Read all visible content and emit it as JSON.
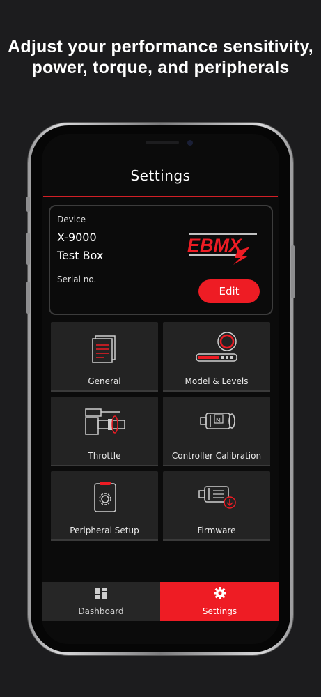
{
  "headline": {
    "line1": "Adjust your performance sensitivity,",
    "line2": "power, torque, and peripherals"
  },
  "header": {
    "title": "Settings"
  },
  "device": {
    "device_label": "Device",
    "name_line1": "X-9000",
    "name_line2": "Test Box",
    "serial_label": "Serial no.",
    "serial_value": "--",
    "logo_text": "EBMX",
    "edit_label": "Edit"
  },
  "tiles": [
    {
      "label": "General",
      "icon": "document-icon"
    },
    {
      "label": "Model & Levels",
      "icon": "level-gauge-icon"
    },
    {
      "label": "Throttle",
      "icon": "throttle-icon"
    },
    {
      "label": "Controller Calibration",
      "icon": "motor-icon"
    },
    {
      "label": "Peripheral Setup",
      "icon": "clipboard-gear-icon"
    },
    {
      "label": "Firmware",
      "icon": "motor-download-icon"
    }
  ],
  "tabbar": {
    "dashboard_label": "Dashboard",
    "settings_label": "Settings",
    "active": "Settings"
  },
  "colors": {
    "accent": "#ee1c24",
    "background": "#0b0b0b",
    "tile": "#232323"
  }
}
